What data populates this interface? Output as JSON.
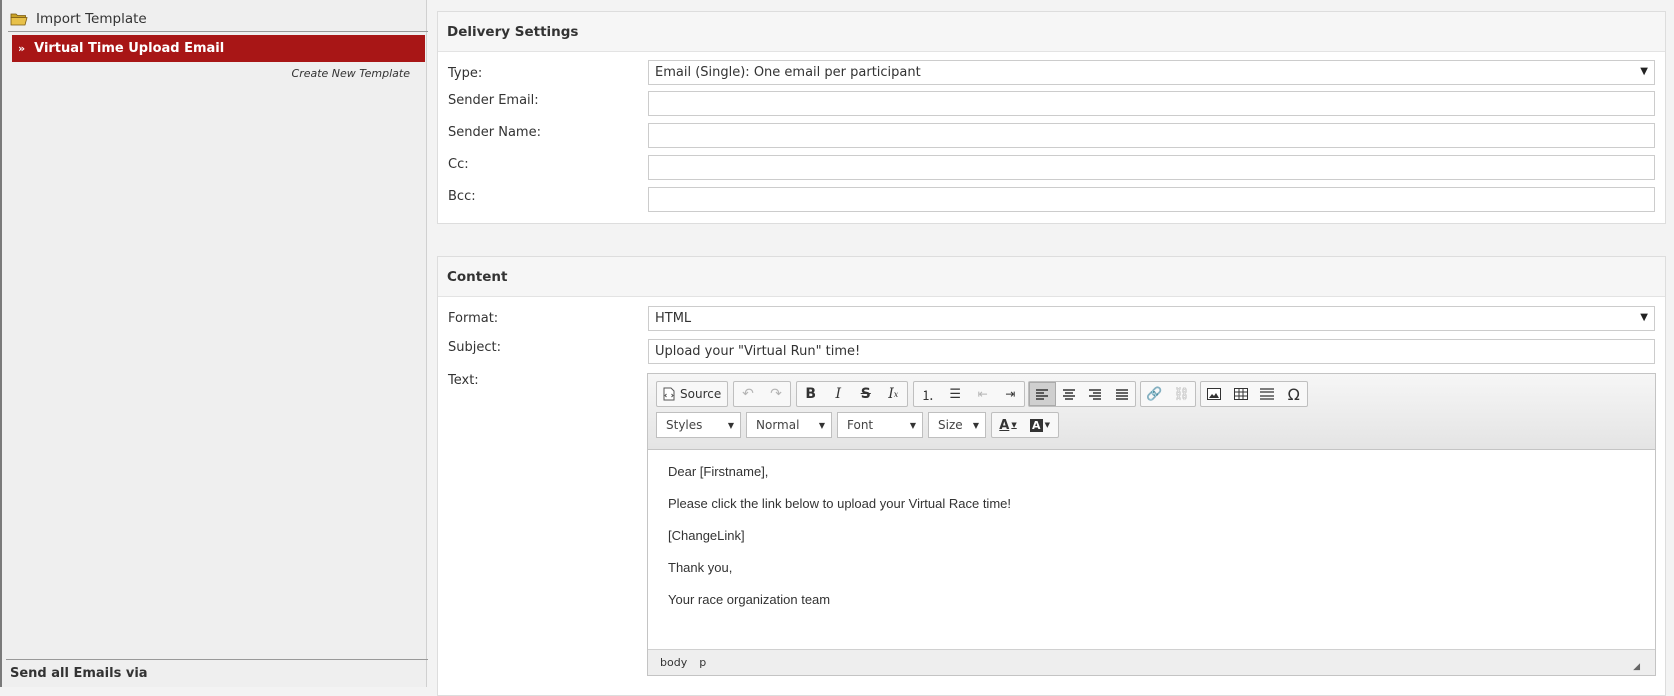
{
  "sidebar": {
    "import_label": "Import Template",
    "template_item": "Virtual Time Upload Email",
    "create_new": "Create New Template",
    "send_all_via": "Send all Emails via"
  },
  "delivery": {
    "title": "Delivery Settings",
    "type_label": "Type:",
    "type_value": "Email (Single): One email per participant",
    "sender_email_label": "Sender Email:",
    "sender_email_value": "",
    "sender_name_label": "Sender Name:",
    "sender_name_value": "",
    "cc_label": "Cc:",
    "cc_value": "",
    "bcc_label": "Bcc:",
    "bcc_value": ""
  },
  "content": {
    "title": "Content",
    "format_label": "Format:",
    "format_value": "HTML",
    "subject_label": "Subject:",
    "subject_value": "Upload your \"Virtual Run\" time!",
    "text_label": "Text:"
  },
  "editor": {
    "source_label": "Source",
    "styles_label": "Styles",
    "format_label": "Normal",
    "font_label": "Font",
    "size_label": "Size",
    "body_lines": [
      "Dear [Firstname],",
      "Please click the link below to upload your Virtual Race time!",
      "[ChangeLink]",
      "Thank you,",
      "Your race organization team"
    ],
    "path": [
      "body",
      "p"
    ]
  },
  "colors": {
    "accent": "#a81616",
    "panel_bg": "#ffffff",
    "page_bg": "#f3f3f3"
  }
}
